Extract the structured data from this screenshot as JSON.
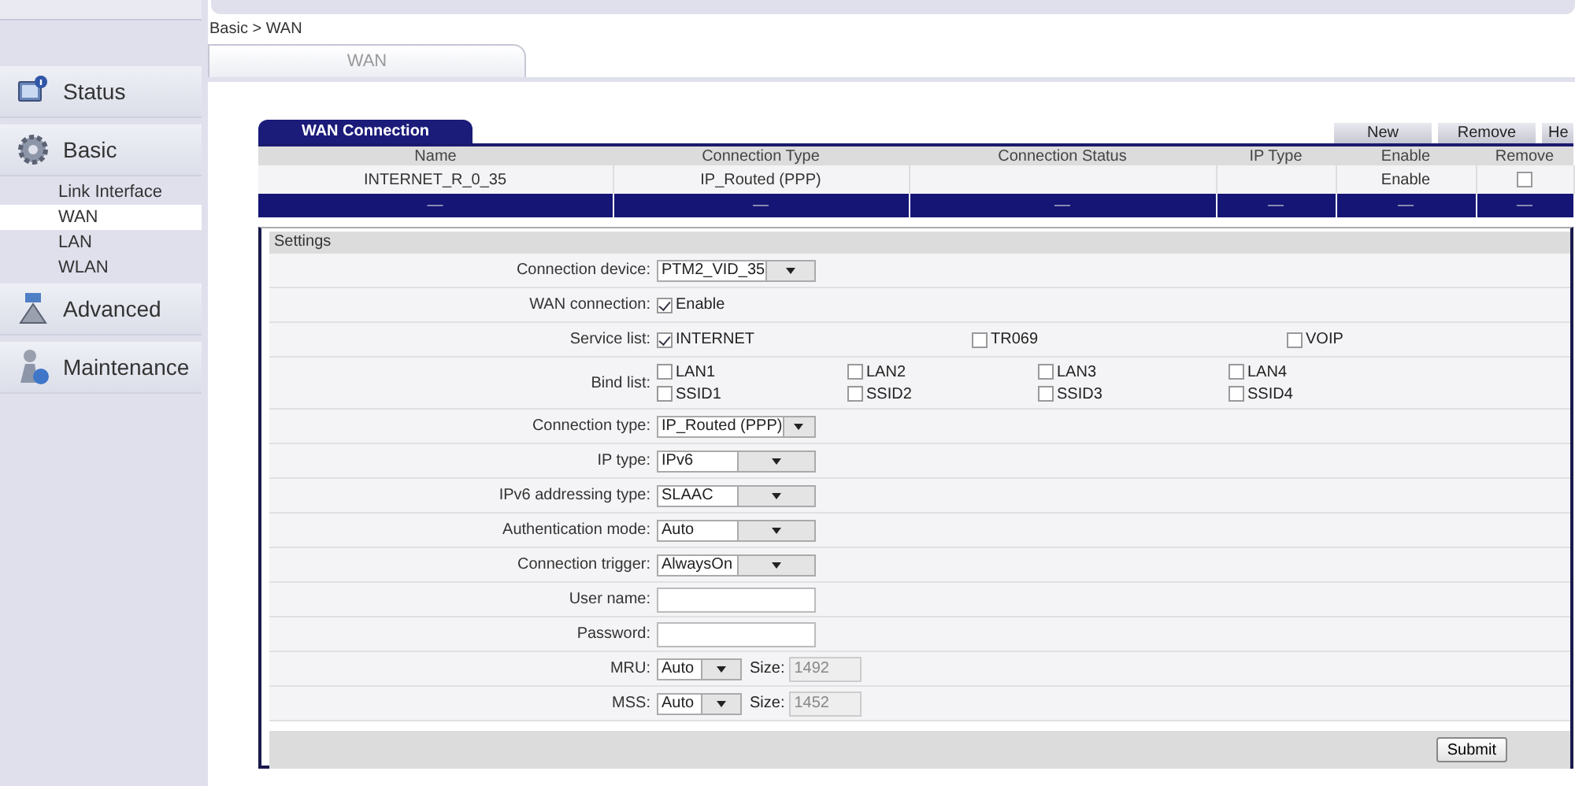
{
  "sidebar": {
    "items": [
      {
        "label": "Status",
        "selected": false
      },
      {
        "label": "Basic",
        "selected": false,
        "children": [
          {
            "label": "Link Interface",
            "selected": false
          },
          {
            "label": "WAN",
            "selected": true
          },
          {
            "label": "LAN",
            "selected": false
          },
          {
            "label": "WLAN",
            "selected": false
          }
        ]
      },
      {
        "label": "Advanced",
        "selected": false
      },
      {
        "label": "Maintenance",
        "selected": false
      }
    ]
  },
  "breadcrumb": "Basic > WAN",
  "tabs": [
    {
      "label": "WAN",
      "selected": true
    }
  ],
  "wan_connection": {
    "title": "WAN Connection",
    "buttons": [
      "New",
      "Remove",
      "He"
    ],
    "columns": [
      "Name",
      "Connection Type",
      "Connection Status",
      "IP Type",
      "Enable",
      "Remove"
    ],
    "rows": [
      {
        "cells": [
          "INTERNET_R_0_35",
          "IP_Routed (PPP)",
          "",
          "",
          "Enable"
        ],
        "checked": false
      }
    ],
    "footer_cells": [
      "—",
      "—",
      "—",
      "—",
      "—",
      "—"
    ]
  },
  "settings": {
    "title": "Settings",
    "fields": [
      {
        "kind": "select",
        "label": "Connection device:",
        "value": "PTM2_VID_35"
      },
      {
        "kind": "checkbox",
        "label": "WAN connection:",
        "options": [
          {
            "label": "Enable",
            "checked": true
          }
        ]
      },
      {
        "kind": "checklist",
        "label": "Service list:",
        "options": [
          {
            "label": "INTERNET",
            "checked": true
          },
          {
            "label": "TR069",
            "checked": false
          },
          {
            "label": "VOIP",
            "checked": false
          }
        ]
      },
      {
        "kind": "checklist",
        "label": "Bind list:",
        "options": [
          {
            "label": "LAN1",
            "checked": false
          },
          {
            "label": "LAN2",
            "checked": false
          },
          {
            "label": "LAN3",
            "checked": false
          },
          {
            "label": "LAN4",
            "checked": false
          },
          {
            "label": "SSID1",
            "checked": false
          },
          {
            "label": "SSID2",
            "checked": false
          },
          {
            "label": "SSID3",
            "checked": false
          },
          {
            "label": "SSID4",
            "checked": false
          }
        ]
      },
      {
        "kind": "select",
        "label": "Connection type:",
        "value": "IP_Routed (PPP)"
      },
      {
        "kind": "select",
        "label": "IP type:",
        "value": "IPv6"
      },
      {
        "kind": "select",
        "label": "IPv6 addressing type:",
        "value": "SLAAC"
      },
      {
        "kind": "select",
        "label": "Authentication mode:",
        "value": "Auto"
      },
      {
        "kind": "select",
        "label": "Connection trigger:",
        "value": "AlwaysOn"
      },
      {
        "kind": "text",
        "label": "User name:"
      },
      {
        "kind": "text",
        "label": "Password:"
      },
      {
        "kind": "select_size",
        "label": "MRU:",
        "value": "Auto",
        "size_label": "Size:",
        "size": "1492"
      },
      {
        "kind": "select_size",
        "label": "MSS:",
        "value": "Auto",
        "size_label": "Size:",
        "size": "1452"
      }
    ],
    "submit": "Submit"
  }
}
